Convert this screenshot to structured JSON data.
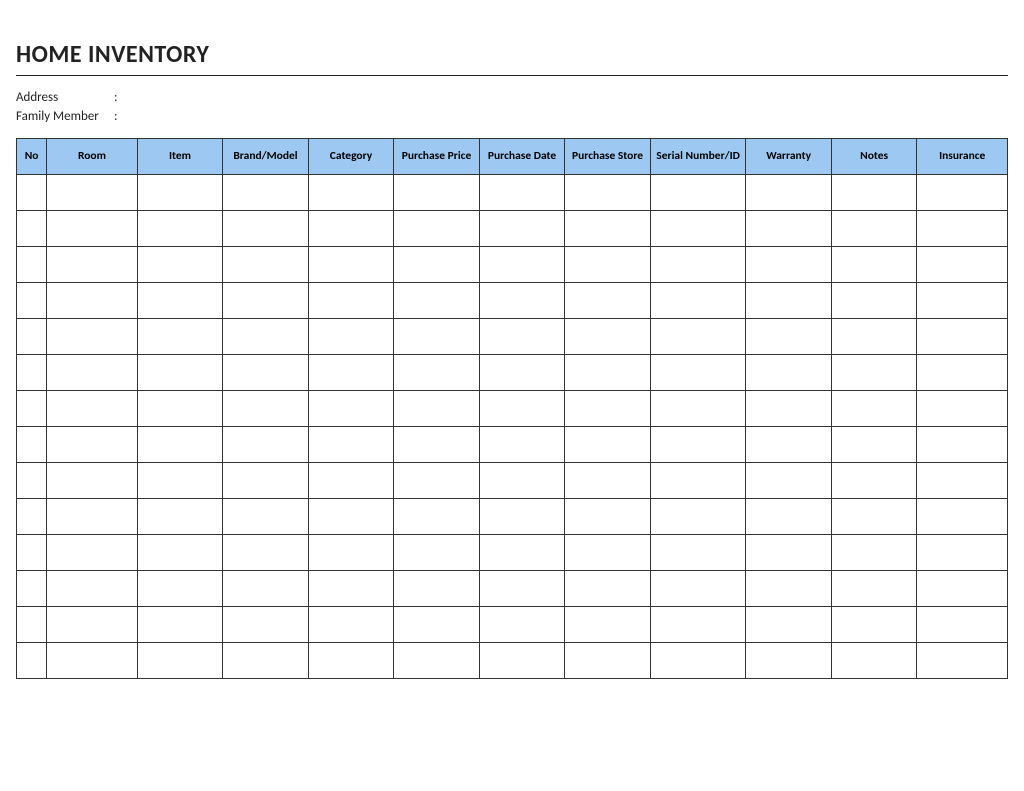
{
  "title": "HOME INVENTORY",
  "meta": {
    "address_label": "Address",
    "address_value": "",
    "family_label": "Family Member",
    "family_value": "",
    "colon": ":"
  },
  "columns": {
    "no": "No",
    "room": "Room",
    "item": "Item",
    "brand": "Brand/Model",
    "category": "Category",
    "price": "Purchase Price",
    "date": "Purchase Date",
    "store": "Purchase Store",
    "serial": "Serial Number/ID",
    "warranty": "Warranty",
    "notes": "Notes",
    "insurance": "Insurance"
  },
  "rows": [
    {
      "no": "",
      "room": "",
      "item": "",
      "brand": "",
      "category": "",
      "price": "",
      "date": "",
      "store": "",
      "serial": "",
      "warranty": "",
      "notes": "",
      "insurance": ""
    },
    {
      "no": "",
      "room": "",
      "item": "",
      "brand": "",
      "category": "",
      "price": "",
      "date": "",
      "store": "",
      "serial": "",
      "warranty": "",
      "notes": "",
      "insurance": ""
    },
    {
      "no": "",
      "room": "",
      "item": "",
      "brand": "",
      "category": "",
      "price": "",
      "date": "",
      "store": "",
      "serial": "",
      "warranty": "",
      "notes": "",
      "insurance": ""
    },
    {
      "no": "",
      "room": "",
      "item": "",
      "brand": "",
      "category": "",
      "price": "",
      "date": "",
      "store": "",
      "serial": "",
      "warranty": "",
      "notes": "",
      "insurance": ""
    },
    {
      "no": "",
      "room": "",
      "item": "",
      "brand": "",
      "category": "",
      "price": "",
      "date": "",
      "store": "",
      "serial": "",
      "warranty": "",
      "notes": "",
      "insurance": ""
    },
    {
      "no": "",
      "room": "",
      "item": "",
      "brand": "",
      "category": "",
      "price": "",
      "date": "",
      "store": "",
      "serial": "",
      "warranty": "",
      "notes": "",
      "insurance": ""
    },
    {
      "no": "",
      "room": "",
      "item": "",
      "brand": "",
      "category": "",
      "price": "",
      "date": "",
      "store": "",
      "serial": "",
      "warranty": "",
      "notes": "",
      "insurance": ""
    },
    {
      "no": "",
      "room": "",
      "item": "",
      "brand": "",
      "category": "",
      "price": "",
      "date": "",
      "store": "",
      "serial": "",
      "warranty": "",
      "notes": "",
      "insurance": ""
    },
    {
      "no": "",
      "room": "",
      "item": "",
      "brand": "",
      "category": "",
      "price": "",
      "date": "",
      "store": "",
      "serial": "",
      "warranty": "",
      "notes": "",
      "insurance": ""
    },
    {
      "no": "",
      "room": "",
      "item": "",
      "brand": "",
      "category": "",
      "price": "",
      "date": "",
      "store": "",
      "serial": "",
      "warranty": "",
      "notes": "",
      "insurance": ""
    },
    {
      "no": "",
      "room": "",
      "item": "",
      "brand": "",
      "category": "",
      "price": "",
      "date": "",
      "store": "",
      "serial": "",
      "warranty": "",
      "notes": "",
      "insurance": ""
    },
    {
      "no": "",
      "room": "",
      "item": "",
      "brand": "",
      "category": "",
      "price": "",
      "date": "",
      "store": "",
      "serial": "",
      "warranty": "",
      "notes": "",
      "insurance": ""
    },
    {
      "no": "",
      "room": "",
      "item": "",
      "brand": "",
      "category": "",
      "price": "",
      "date": "",
      "store": "",
      "serial": "",
      "warranty": "",
      "notes": "",
      "insurance": ""
    },
    {
      "no": "",
      "room": "",
      "item": "",
      "brand": "",
      "category": "",
      "price": "",
      "date": "",
      "store": "",
      "serial": "",
      "warranty": "",
      "notes": "",
      "insurance": ""
    }
  ]
}
